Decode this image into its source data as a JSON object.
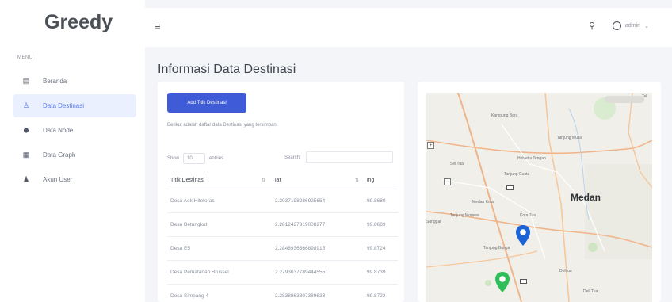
{
  "sidebar": {
    "brand": "Greedy",
    "menu_label": "MENU",
    "items": [
      {
        "label": "Beranda",
        "icon": "grid-icon",
        "glyph": "▤"
      },
      {
        "label": "Data Destinasi",
        "icon": "user-icon",
        "glyph": "♙"
      },
      {
        "label": "Data Node",
        "icon": "map-pin-icon",
        "glyph": "⬤"
      },
      {
        "label": "Data Graph",
        "icon": "table-icon",
        "glyph": "▦"
      },
      {
        "label": "Akun User",
        "icon": "users-icon",
        "glyph": "♟"
      }
    ]
  },
  "topbar": {
    "menu_glyph": "≡",
    "search_glyph": "⚲",
    "user_name": "admin",
    "chevron": "⌄"
  },
  "page": {
    "title": "Informasi Data Destinasi"
  },
  "left_card": {
    "add_button": "Add Titik Destinasi",
    "description": "Berikut adalah daftar data Destinasi yang tersimpan.",
    "show_label": "Show",
    "show_value": "10",
    "entries_label": "entries",
    "search_label": "Search:",
    "columns": [
      "Titik Destinasi",
      "lat",
      "lng"
    ],
    "rows": [
      [
        "Desa Aek Hitetoras",
        "2.3037198286925654",
        "99.8680"
      ],
      [
        "Desa Betungkut",
        "2.2812427319008277",
        "99.8689"
      ],
      [
        "Desa E5",
        "2.2848936366898915",
        "99.8724"
      ],
      [
        "Desa Pematanan Brussel",
        "2.2793637789444555",
        "99.8739"
      ],
      [
        "Desa Simpang 4",
        "2.2838863307389633",
        "99.8722"
      ]
    ]
  },
  "map": {
    "city": "Medan",
    "labels": [
      {
        "text": "Kampung Baru",
        "cls": "lbl-kampung"
      },
      {
        "text": "Tanjung Mulia",
        "cls": "lbl-tmulia"
      },
      {
        "text": "Sei Tua",
        "cls": "lbl-seitua"
      },
      {
        "text": "Helvetia Tengah",
        "cls": "lbl-helvetia"
      },
      {
        "text": "Tanjung Gusta",
        "cls": "lbl-tgusta"
      },
      {
        "text": "Medan Kota",
        "cls": "lbl-mkota"
      },
      {
        "text": "Tanjung Morawa",
        "cls": "lbl-tmorawa"
      },
      {
        "text": "Sunggal",
        "cls": "lbl-sunggal"
      },
      {
        "text": "Kota Tua",
        "cls": "lbl-kotatua"
      },
      {
        "text": "Tanjung Bunga",
        "cls": "lbl-tbunga"
      },
      {
        "text": "Delitua",
        "cls": "lbl-delitua"
      },
      {
        "text": "Deli Tua",
        "cls": "lbl-delitua2"
      }
    ],
    "zoom_in": "+",
    "zoom_out": "−",
    "corner_text": "Tel",
    "pin_colors": {
      "blue": "#1a63d8",
      "green": "#2fbf5a"
    }
  }
}
